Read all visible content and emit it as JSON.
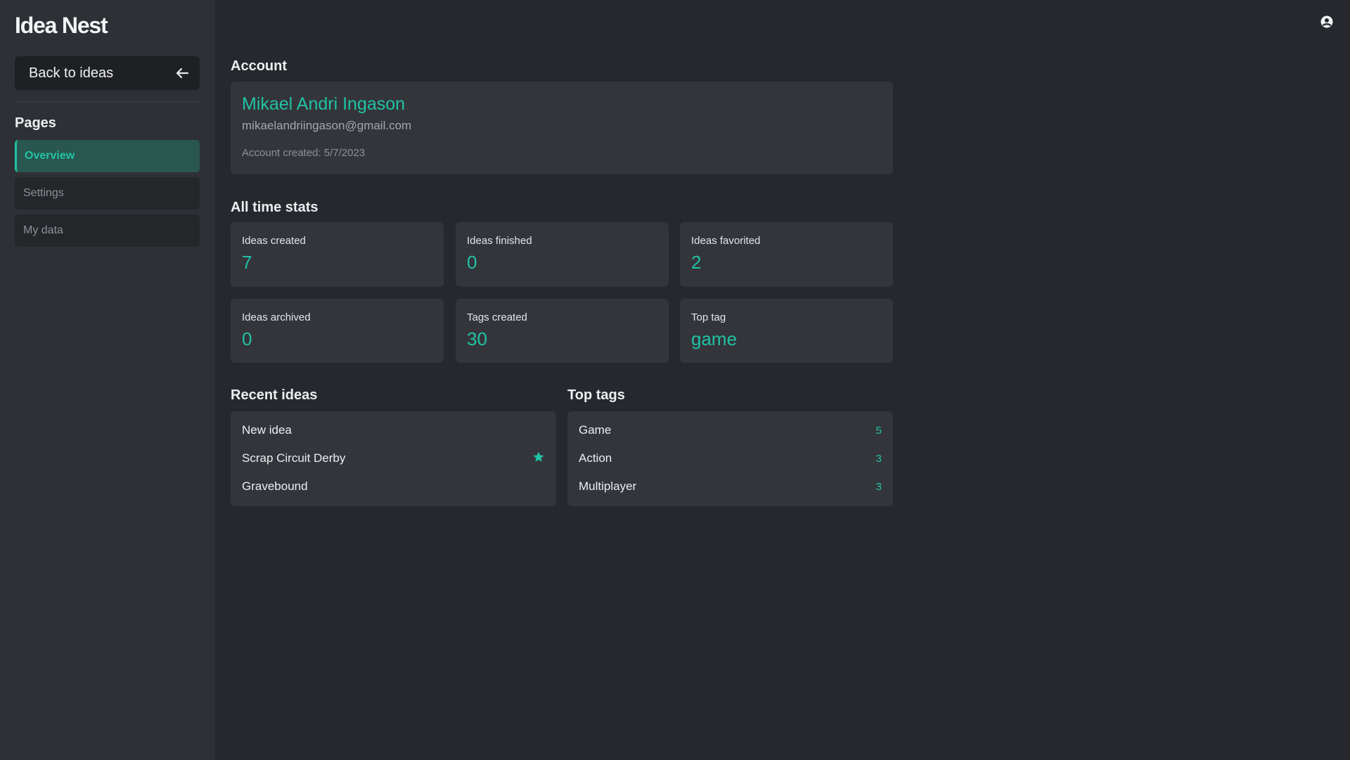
{
  "app": {
    "name": "Idea Nest"
  },
  "sidebar": {
    "back_label": "Back to ideas",
    "pages_title": "Pages",
    "items": [
      {
        "label": "Overview",
        "active": true
      },
      {
        "label": "Settings",
        "active": false
      },
      {
        "label": "My data",
        "active": false
      }
    ]
  },
  "account": {
    "title": "Account",
    "name": "Mikael Andri Ingason",
    "email": "mikaelandriingason@gmail.com",
    "created": "Account created: 5/7/2023"
  },
  "stats": {
    "title": "All time stats",
    "items": [
      {
        "label": "Ideas created",
        "value": "7"
      },
      {
        "label": "Ideas finished",
        "value": "0"
      },
      {
        "label": "Ideas favorited",
        "value": "2"
      },
      {
        "label": "Ideas archived",
        "value": "0"
      },
      {
        "label": "Tags created",
        "value": "30"
      },
      {
        "label": "Top tag",
        "value": "game"
      }
    ]
  },
  "recent_ideas": {
    "title": "Recent ideas",
    "items": [
      {
        "name": "New idea",
        "favorited": false
      },
      {
        "name": "Scrap Circuit Derby",
        "favorited": true
      },
      {
        "name": "Gravebound",
        "favorited": false
      }
    ]
  },
  "top_tags": {
    "title": "Top tags",
    "items": [
      {
        "name": "Game",
        "count": "5"
      },
      {
        "name": "Action",
        "count": "3"
      },
      {
        "name": "Multiplayer",
        "count": "3"
      }
    ]
  },
  "colors": {
    "accent": "#20c2a4",
    "background": "#27282d",
    "sidebar": "#2f3036",
    "card": "#34353b"
  },
  "icons": {
    "back": "arrow-left-icon",
    "user": "user-circle-icon",
    "favorite": "star-icon"
  }
}
